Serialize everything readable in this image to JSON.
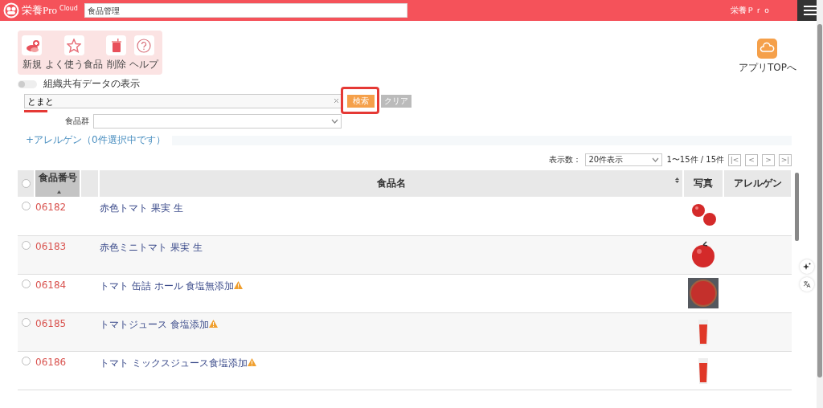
{
  "header": {
    "logo_text": "栄養Pro",
    "logo_sup": "Cloud",
    "breadcrumb": "食品管理",
    "app_name": "栄養Ｐｒｏ"
  },
  "toolbar": [
    {
      "label": "新規",
      "kind": "new"
    },
    {
      "label": "よく使う食品",
      "kind": "favorite"
    },
    {
      "label": "削除",
      "kind": "delete"
    },
    {
      "label": "ヘルプ",
      "kind": "help"
    }
  ],
  "app_top": {
    "label": "アプリTOPへ"
  },
  "shared_toggle": {
    "label": "組織共有データの表示",
    "on": false
  },
  "search": {
    "value": "とまと",
    "search_button": "検索",
    "clear_button": "クリア",
    "highlighted": true
  },
  "food_group": {
    "label": "食品群"
  },
  "allergen_link": "+アレルゲン（0件選択中です）",
  "pagination": {
    "page_size_label": "表示数：",
    "page_size": "20件表示",
    "range": "1〜15件 / 15件",
    "buttons": [
      "|<",
      "<",
      ">",
      ">|"
    ]
  },
  "table": {
    "all_selected": false,
    "columns": [
      {
        "label": "食品番号",
        "sorted": true,
        "sortable": true
      },
      {
        "label": "食品名",
        "sorted": false,
        "sortable": true
      },
      {
        "label": "写真",
        "sorted": false,
        "sortable": false
      },
      {
        "label": "アレルゲン",
        "sorted": false,
        "sortable": false
      }
    ],
    "rows": [
      {
        "number": "06182",
        "name": "赤色トマト 果実 生",
        "warning": false,
        "selected": false
      },
      {
        "number": "06183",
        "name": "赤色ミニトマト 果実 生",
        "warning": false,
        "selected": false
      },
      {
        "number": "06184",
        "name": "トマト 缶詰 ホール 食塩無添加",
        "warning": true,
        "selected": false
      },
      {
        "number": "06185",
        "name": "トマトジュース 食塩添加",
        "warning": true,
        "selected": false
      },
      {
        "number": "06186",
        "name": "トマト ミックスジュース食塩添加",
        "warning": true,
        "selected": false
      }
    ]
  }
}
